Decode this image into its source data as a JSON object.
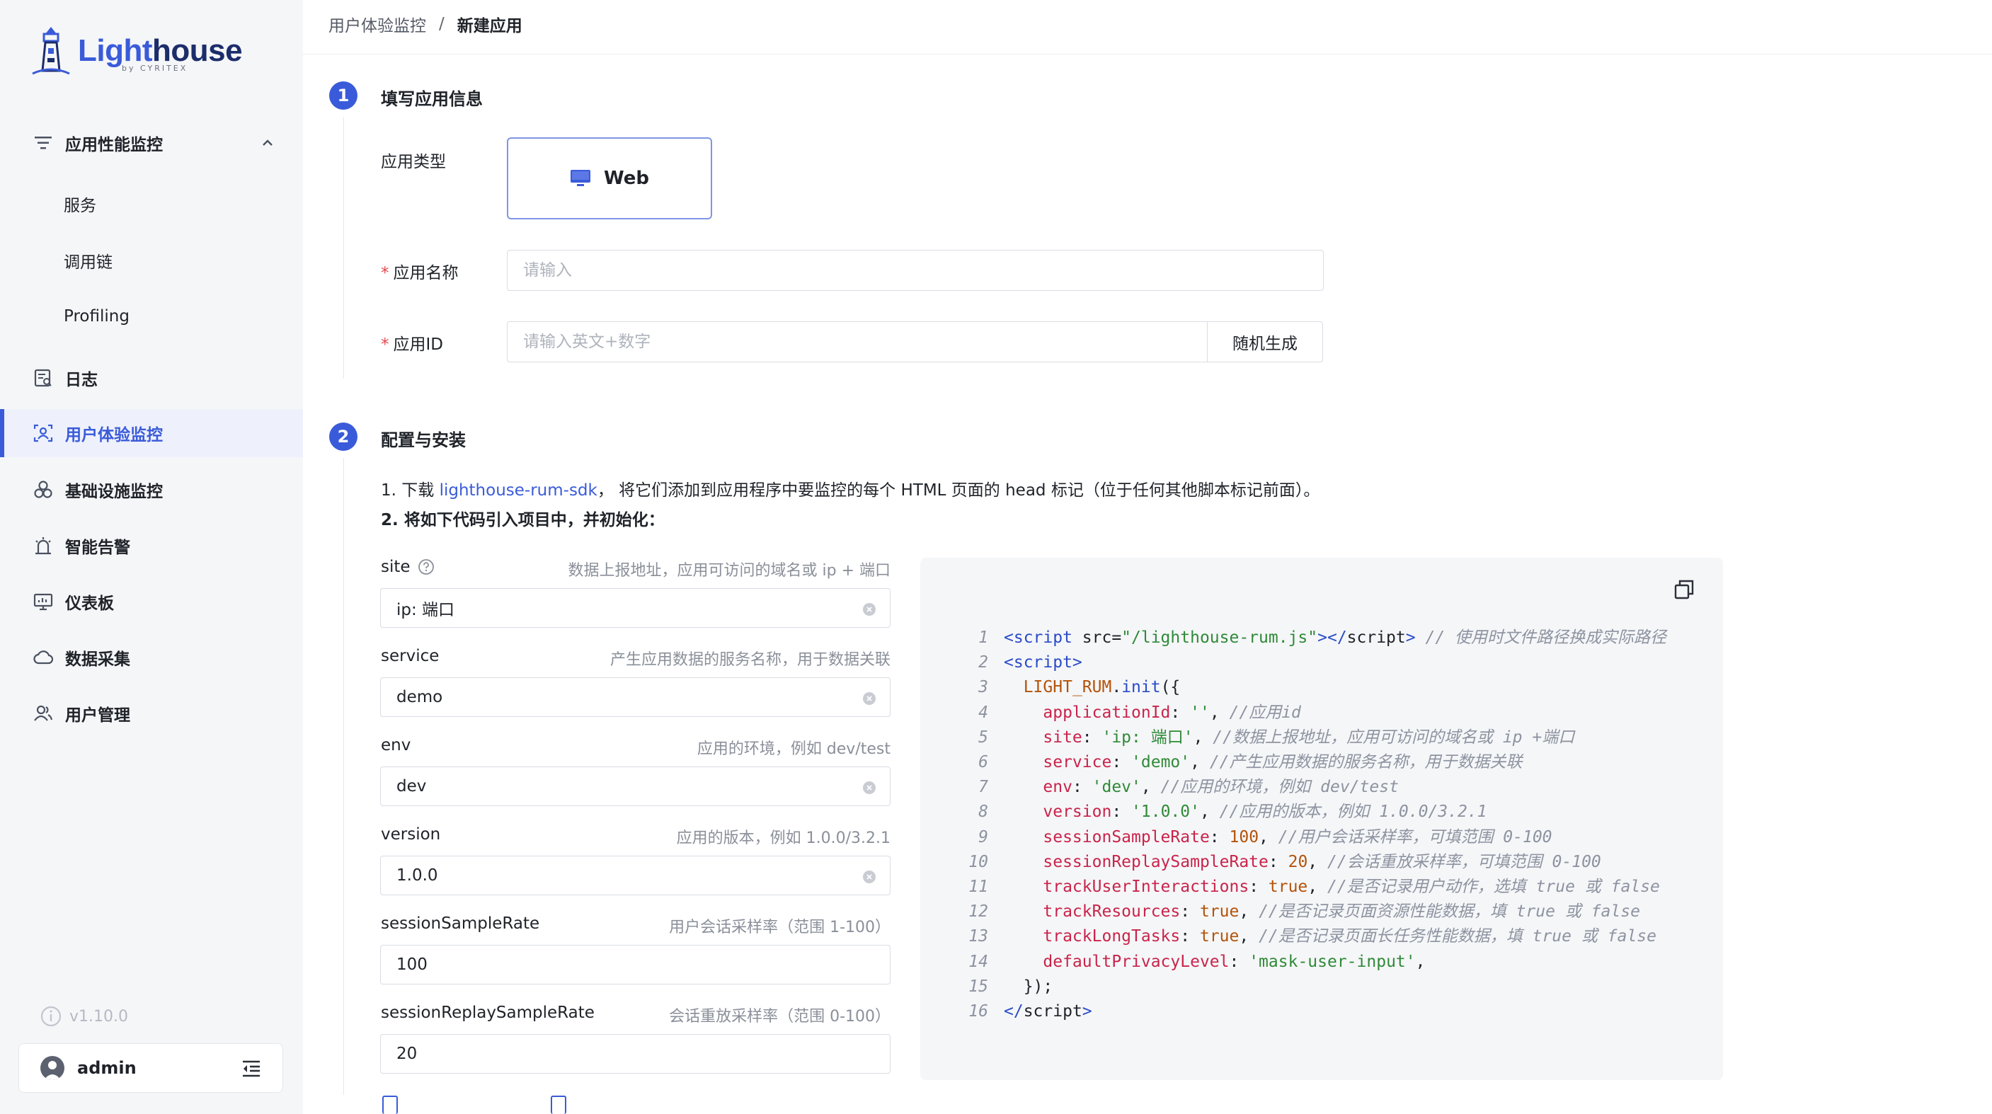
{
  "app": {
    "logo_part1": "Light",
    "logo_part2": "house",
    "logo_sub": "by CYRITEX"
  },
  "sidebar": {
    "groups": [
      {
        "label": "应用性能监控",
        "icon": "filter-lines-icon",
        "expanded": true,
        "children": [
          "服务",
          "调用链",
          "Profiling"
        ]
      },
      {
        "label": "日志",
        "icon": "log-doc-icon"
      },
      {
        "label": "用户体验监控",
        "icon": "user-scan-icon",
        "active": true
      },
      {
        "label": "基础设施监控",
        "icon": "infra-circles-icon"
      },
      {
        "label": "智能告警",
        "icon": "alarm-icon"
      },
      {
        "label": "仪表板",
        "icon": "dashboard-monitor-icon"
      },
      {
        "label": "数据采集",
        "icon": "cloud-collect-icon"
      },
      {
        "label": "用户管理",
        "icon": "users-icon"
      }
    ],
    "version": "v1.10.0",
    "user": "admin"
  },
  "breadcrumb": {
    "parent": "用户体验监控",
    "separator": "/",
    "current": "新建应用"
  },
  "step1": {
    "number": "1",
    "title": "填写应用信息",
    "app_type_label": "应用类型",
    "app_type_option": "Web",
    "app_name_label": "应用名称",
    "app_name_placeholder": "请输入",
    "app_id_label": "应用ID",
    "app_id_placeholder": "请输入英文+数字",
    "random_button": "随机生成"
  },
  "step2": {
    "number": "2",
    "title": "配置与安装",
    "instruction1_prefix": "1. 下载 ",
    "instruction1_link": "lighthouse-rum-sdk",
    "instruction1_suffix": "， 将它们添加到应用程序中要监控的每个 HTML 页面的 head 标记（位于任何其他脚本标记前面）。",
    "instruction2": "2. 将如下代码引入项目中，并初始化：",
    "fields": [
      {
        "name": "site",
        "hint": "数据上报地址，应用可访问的域名或 ip + 端口",
        "value": "ip: 端口",
        "clearable": true,
        "help": true
      },
      {
        "name": "service",
        "hint": "产生应用数据的服务名称，用于数据关联",
        "value": "demo",
        "clearable": true
      },
      {
        "name": "env",
        "hint": "应用的环境，例如 dev/test",
        "value": "dev",
        "clearable": true
      },
      {
        "name": "version",
        "hint": "应用的版本，例如 1.0.0/3.2.1",
        "value": "1.0.0",
        "clearable": true
      },
      {
        "name": "sessionSampleRate",
        "hint": "用户会话采样率（范围 1-100）",
        "value": "100"
      },
      {
        "name": "sessionReplaySampleRate",
        "hint": "会话重放采样率（范围 0-100）",
        "value": "20"
      }
    ]
  },
  "code": {
    "lines": [
      {
        "n": "1",
        "parts": [
          [
            "tag",
            "<script "
          ],
          [
            "txt",
            "src="
          ],
          [
            "str",
            "\"/lighthouse-rum.js\""
          ],
          [
            "tag",
            "></"
          ],
          [
            "txt",
            "script"
          ],
          [
            "tag",
            ">"
          ],
          [
            "cm",
            " // 使用时文件路径换成实际路径"
          ]
        ]
      },
      {
        "n": "2",
        "parts": [
          [
            "tag",
            "<script>"
          ]
        ]
      },
      {
        "n": "3",
        "parts": [
          [
            "txt",
            "  "
          ],
          [
            "glob",
            "LIGHT_RUM"
          ],
          [
            "txt",
            "."
          ],
          [
            "fn",
            "init"
          ],
          [
            "txt",
            "({"
          ]
        ]
      },
      {
        "n": "4",
        "parts": [
          [
            "txt",
            "    "
          ],
          [
            "key",
            "applicationId"
          ],
          [
            "txt",
            ": "
          ],
          [
            "str",
            "''"
          ],
          [
            "txt",
            ", "
          ],
          [
            "cm",
            "//应用id"
          ]
        ]
      },
      {
        "n": "5",
        "parts": [
          [
            "txt",
            "    "
          ],
          [
            "key",
            "site"
          ],
          [
            "txt",
            ": "
          ],
          [
            "str",
            "'ip: 端口'"
          ],
          [
            "txt",
            ", "
          ],
          [
            "cm",
            "//数据上报地址，应用可访问的域名或 ip +端口"
          ]
        ]
      },
      {
        "n": "6",
        "parts": [
          [
            "txt",
            "    "
          ],
          [
            "key",
            "service"
          ],
          [
            "txt",
            ": "
          ],
          [
            "str",
            "'demo'"
          ],
          [
            "txt",
            ", "
          ],
          [
            "cm",
            "//产生应用数据的服务名称，用于数据关联"
          ]
        ]
      },
      {
        "n": "7",
        "parts": [
          [
            "txt",
            "    "
          ],
          [
            "key",
            "env"
          ],
          [
            "txt",
            ": "
          ],
          [
            "str",
            "'dev'"
          ],
          [
            "txt",
            ", "
          ],
          [
            "cm",
            "//应用的环境，例如 dev/test"
          ]
        ]
      },
      {
        "n": "8",
        "parts": [
          [
            "txt",
            "    "
          ],
          [
            "key",
            "version"
          ],
          [
            "txt",
            ": "
          ],
          [
            "str",
            "'1.0.0'"
          ],
          [
            "txt",
            ", "
          ],
          [
            "cm",
            "//应用的版本，例如 1.0.0/3.2.1"
          ]
        ]
      },
      {
        "n": "9",
        "parts": [
          [
            "txt",
            "    "
          ],
          [
            "key",
            "sessionSampleRate"
          ],
          [
            "txt",
            ": "
          ],
          [
            "num",
            "100"
          ],
          [
            "txt",
            ", "
          ],
          [
            "cm",
            "//用户会话采样率，可填范围 0-100"
          ]
        ]
      },
      {
        "n": "10",
        "parts": [
          [
            "txt",
            "    "
          ],
          [
            "key",
            "sessionReplaySampleRate"
          ],
          [
            "txt",
            ": "
          ],
          [
            "num",
            "20"
          ],
          [
            "txt",
            ", "
          ],
          [
            "cm",
            "//会话重放采样率，可填范围 0-100"
          ]
        ]
      },
      {
        "n": "11",
        "parts": [
          [
            "txt",
            "    "
          ],
          [
            "key",
            "trackUserInteractions"
          ],
          [
            "txt",
            ": "
          ],
          [
            "kw",
            "true"
          ],
          [
            "txt",
            ", "
          ],
          [
            "cm",
            "//是否记录用户动作，选填 true 或 false"
          ]
        ]
      },
      {
        "n": "12",
        "parts": [
          [
            "txt",
            "    "
          ],
          [
            "key",
            "trackResources"
          ],
          [
            "txt",
            ": "
          ],
          [
            "kw",
            "true"
          ],
          [
            "txt",
            ", "
          ],
          [
            "cm",
            "//是否记录页面资源性能数据，填 true 或 false"
          ]
        ]
      },
      {
        "n": "13",
        "parts": [
          [
            "txt",
            "    "
          ],
          [
            "key",
            "trackLongTasks"
          ],
          [
            "txt",
            ": "
          ],
          [
            "kw",
            "true"
          ],
          [
            "txt",
            ", "
          ],
          [
            "cm",
            "//是否记录页面长任务性能数据，填 true 或 false"
          ]
        ]
      },
      {
        "n": "14",
        "parts": [
          [
            "txt",
            "    "
          ],
          [
            "key",
            "defaultPrivacyLevel"
          ],
          [
            "txt",
            ": "
          ],
          [
            "str",
            "'mask-user-input'"
          ],
          [
            "txt",
            ","
          ]
        ]
      },
      {
        "n": "15",
        "parts": [
          [
            "txt",
            "  "
          ],
          [
            "txt",
            "});"
          ]
        ]
      },
      {
        "n": "16",
        "parts": [
          [
            "tag",
            "</"
          ],
          [
            "txt",
            "script"
          ],
          [
            "tag",
            ">"
          ]
        ]
      }
    ]
  },
  "colors": {
    "accent": "#3a5bd9",
    "sidebar_bg": "#f5f6f8",
    "required": "#e5484d"
  }
}
